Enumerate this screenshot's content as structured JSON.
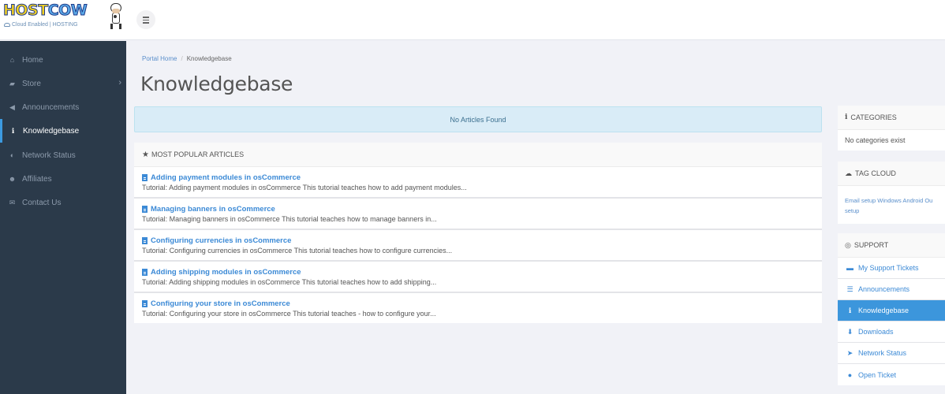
{
  "brand": {
    "name_part1": "HOST",
    "name_part2": "COW",
    "tagline": "Cloud Enabled | HOSTING"
  },
  "header": {
    "menu_toggle_icon": "hamburger-icon"
  },
  "sidebar": {
    "items": [
      {
        "label": "Home",
        "icon": "home-icon",
        "glyph": "⌂"
      },
      {
        "label": "Store",
        "icon": "basket-icon",
        "glyph": "▰",
        "has_submenu": true,
        "chevron": "›"
      },
      {
        "label": "Announcements",
        "icon": "bullhorn-icon",
        "glyph": "◀"
      },
      {
        "label": "Knowledgebase",
        "icon": "info-circle-icon",
        "glyph": "ℹ",
        "active": true
      },
      {
        "label": "Network Status",
        "icon": "tachometer-icon",
        "glyph": "◐"
      },
      {
        "label": "Affiliates",
        "icon": "users-icon",
        "glyph": "☻"
      },
      {
        "label": "Contact Us",
        "icon": "envelope-icon",
        "glyph": "✉"
      }
    ]
  },
  "breadcrumb": {
    "home": "Portal Home",
    "separator": "/",
    "current": "Knowledgebase"
  },
  "page": {
    "title": "Knowledgebase"
  },
  "alert": {
    "message": "No Articles Found"
  },
  "popular": {
    "heading": "MOST POPULAR ARTICLES",
    "heading_icon": "star-icon",
    "articles": [
      {
        "title": "Adding payment modules in osCommerce",
        "description": "Tutorial: Adding payment modules in osCommerce This tutorial teaches how to add payment modules..."
      },
      {
        "title": "Managing banners in osCommerce",
        "description": "Tutorial: Managing banners in osCommerce This tutorial teaches how to manage banners in..."
      },
      {
        "title": "Configuring currencies in osCommerce",
        "description": "Tutorial: Configuring currencies in osCommerce This tutorial teaches how to configure currencies..."
      },
      {
        "title": "Adding shipping modules in osCommerce",
        "description": "Tutorial: Adding shipping modules in osCommerce This tutorial teaches how to add shipping..."
      },
      {
        "title": "Configuring your store in osCommerce",
        "description": "Tutorial: Configuring your store in osCommerce This tutorial teaches - how to configure your..."
      }
    ]
  },
  "categories": {
    "heading": "CATEGORIES",
    "heading_icon": "info-icon",
    "empty_text": "No categories exist"
  },
  "tag_cloud": {
    "heading": "TAG CLOUD",
    "heading_icon": "cloud-icon",
    "tags": [
      "Email setup",
      "Windows",
      "Android",
      "Ou",
      "setup"
    ]
  },
  "support": {
    "heading": "SUPPORT",
    "heading_icon": "life-ring-icon",
    "items": [
      {
        "label": "My Support Tickets",
        "icon": "ticket-icon",
        "glyph": "▬"
      },
      {
        "label": "Announcements",
        "icon": "list-icon",
        "glyph": "☰"
      },
      {
        "label": "Knowledgebase",
        "icon": "info-circle-icon",
        "glyph": "ℹ",
        "active": true
      },
      {
        "label": "Downloads",
        "icon": "download-icon",
        "glyph": "⬇"
      },
      {
        "label": "Network Status",
        "icon": "rocket-icon",
        "glyph": "➤"
      },
      {
        "label": "Open Ticket",
        "icon": "comments-icon",
        "glyph": "●"
      }
    ]
  },
  "colors": {
    "sidebar_bg": "#2b3a4a",
    "accent": "#3c96dc",
    "link": "#3c8ad6",
    "alert_bg": "#d9ecf7",
    "page_bg": "#f1f2f7"
  }
}
